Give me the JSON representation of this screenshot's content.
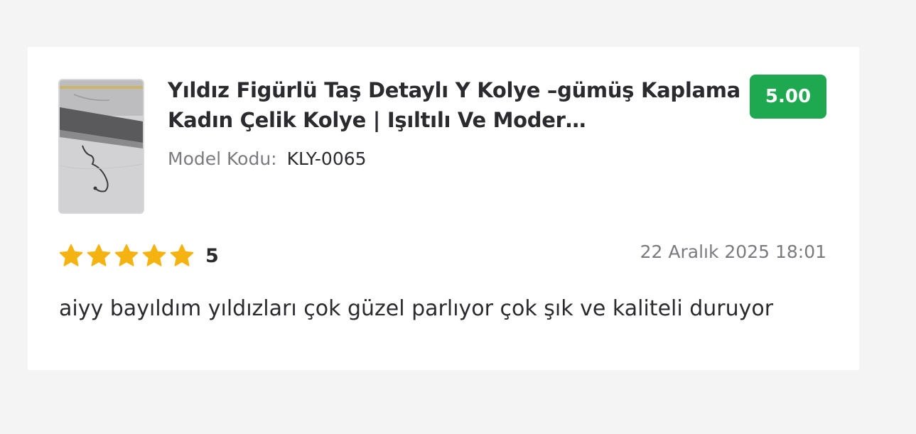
{
  "review": {
    "product_title": "Yıldız Figürlü Taş Detaylı Y Kolye –gümüş Kaplama Kadın Çelik Kolye | Işıltılı Ve Moder…",
    "model_label": "Model Kodu:",
    "model_code": "KLY-0065",
    "score": "5.00",
    "stars_filled": 5,
    "stars_total": 5,
    "rating_value": "5",
    "date": "22 Aralık 2025 18:01",
    "comment": "aiyy bayıldım yıldızları çok güzel parlıyor çok şık ve kaliteli duruyor",
    "thumbnail_icon": "product-photo-necklace",
    "star_icon": "star-icon",
    "colors": {
      "badge": "#1ea850",
      "star": "#f5b312",
      "text": "#2b2b2f",
      "muted": "#7a7a80"
    }
  }
}
